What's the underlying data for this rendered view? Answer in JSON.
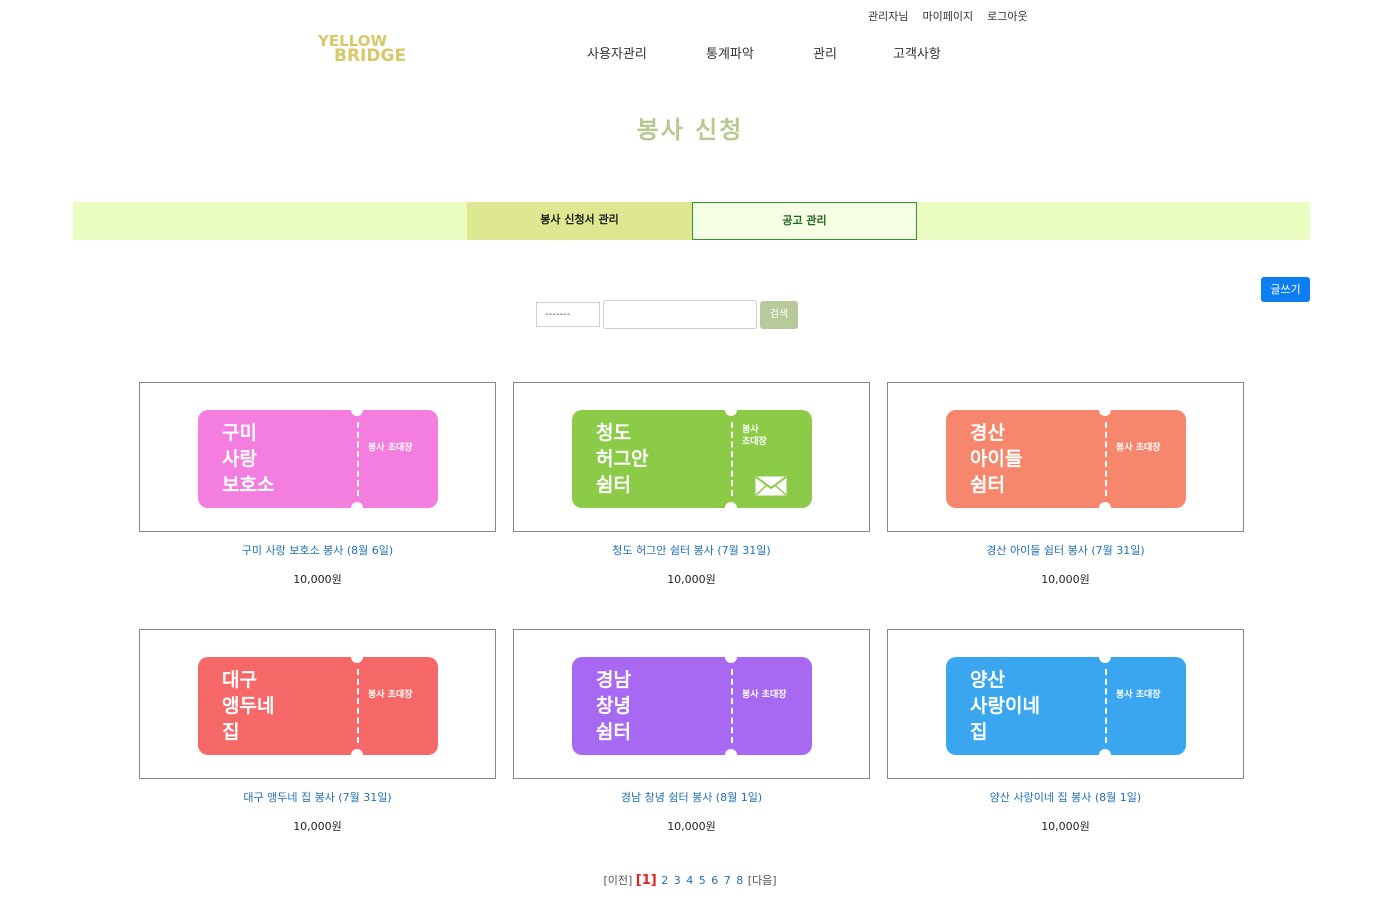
{
  "header": {
    "logo_line1": "YELLOW",
    "logo_line2": "BRIDGE",
    "top_links": [
      "관리자님",
      "마이페이지",
      "로그아웃"
    ],
    "nav": [
      "사용자관리",
      "통계파악",
      "관리",
      "고객사항"
    ]
  },
  "page_title": "봉사 신청",
  "tabs": [
    "봉사 신청서 관리",
    "공고 관리"
  ],
  "write_button": "글쓰기",
  "search": {
    "select_value": "-------",
    "input_value": "",
    "button_label": "검색"
  },
  "colors": {
    "pink": "#f37ee0",
    "green": "#8ccb47",
    "orange": "#f6876c",
    "red": "#f66767",
    "purple": "#a769f2",
    "blue": "#3aa6ef"
  },
  "cards": [
    {
      "ticket_name": "구미\n사랑\n보호소",
      "stub_text": "봉사 초대장",
      "color": "#f37ee0",
      "title": "구미 사랑 보호소 봉사 (8월 6일)",
      "price": "10,000원"
    },
    {
      "ticket_name": "청도\n허그안\n쉼터",
      "stub_text": "봉사\n초대장",
      "color": "#8ccb47",
      "title": "청도 허그안 쉼터 봉사 (7월 31일)",
      "price": "10,000원",
      "envelope_icon": true
    },
    {
      "ticket_name": "경산\n아이들\n쉼터",
      "stub_text": "봉사 초대장",
      "color": "#f6876c",
      "title": "경산 아이들 쉼터 봉사 (7월 31일)",
      "price": "10,000원"
    },
    {
      "ticket_name": "대구\n앵두네\n집",
      "stub_text": "봉사 초대장",
      "color": "#f66767",
      "title": "대구 앵두네 집 봉사 (7월 31일)",
      "price": "10,000원"
    },
    {
      "ticket_name": "경남\n창녕\n쉼터",
      "stub_text": "봉사 초대장",
      "color": "#a769f2",
      "title": "경남 창녕 쉼터 봉사 (8월 1일)",
      "price": "10,000원"
    },
    {
      "ticket_name": "양산\n사랑이네\n집",
      "stub_text": "봉사 초대장",
      "color": "#3aa6ef",
      "title": "양산 사랑이네 집 봉사 (8월 1일)",
      "price": "10,000원"
    }
  ],
  "pagination": {
    "prev": "[이전]",
    "current": "[1]",
    "pages": [
      "2",
      "3",
      "4",
      "5",
      "6",
      "7",
      "8"
    ],
    "next": "[다음]"
  }
}
